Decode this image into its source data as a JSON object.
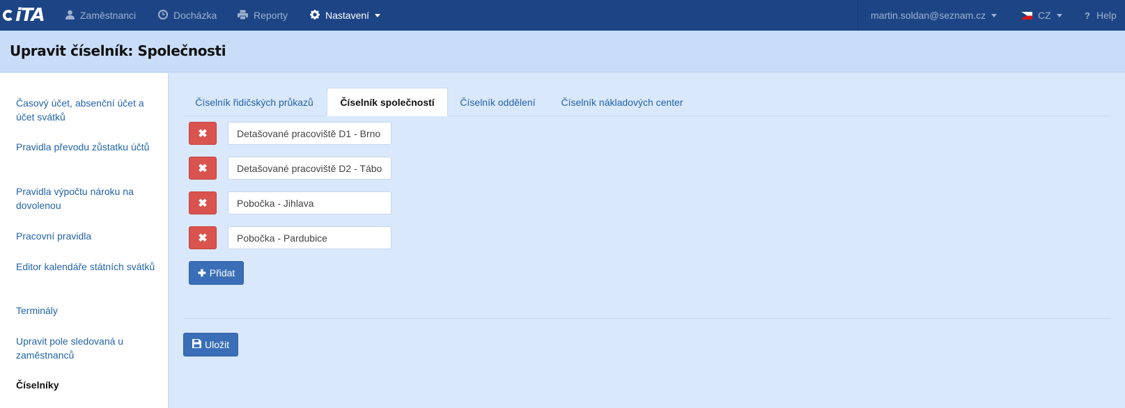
{
  "navbar": {
    "logo_text": "iTA",
    "items": [
      {
        "icon": "user-icon",
        "label": "Zaměstnanci"
      },
      {
        "icon": "clock-icon",
        "label": "Docházka"
      },
      {
        "icon": "print-icon",
        "label": "Reporty"
      },
      {
        "icon": "gear-icon",
        "label": "Nastavení"
      }
    ],
    "user_email": "martin.soldan@seznam.cz",
    "language": "CZ",
    "help_label": "Help"
  },
  "page": {
    "title": "Upravit číselník: Společnosti"
  },
  "sidebar": {
    "items": [
      {
        "label": "Časový účet, absenční účet a účet svátků",
        "active": false
      },
      {
        "label": "Pravidla převodu zůstatku účtů",
        "active": false
      },
      {
        "label": "Pravidla výpočtu nároku na dovolenou",
        "active": false
      },
      {
        "label": "Pracovní pravidla",
        "active": false
      },
      {
        "label": "Editor kalendáře státních svátků",
        "active": false
      },
      {
        "label": "Terminály",
        "active": false
      },
      {
        "label": "Upravit pole sledovaná u zaměstnanců",
        "active": false
      },
      {
        "label": "Číselníky",
        "active": true
      }
    ]
  },
  "tabs": [
    {
      "label": "Číselník řidičských průkazů",
      "active": false
    },
    {
      "label": "Číselník společností",
      "active": true
    },
    {
      "label": "Číselník oddělení",
      "active": false
    },
    {
      "label": "Číselník nákladových center",
      "active": false
    }
  ],
  "entries": [
    "Detašované pracoviště D1 - Brno",
    "Detašované pracoviště D2 - Tábor",
    "Pobočka - Jihlava",
    "Pobočka - Pardubice"
  ],
  "buttons": {
    "add_label": "Přidat",
    "save_label": "Uložit"
  },
  "colors": {
    "navbar": "#1d4585",
    "accent": "#3a6fb7",
    "danger": "#d9534f",
    "link": "#2364a8"
  }
}
